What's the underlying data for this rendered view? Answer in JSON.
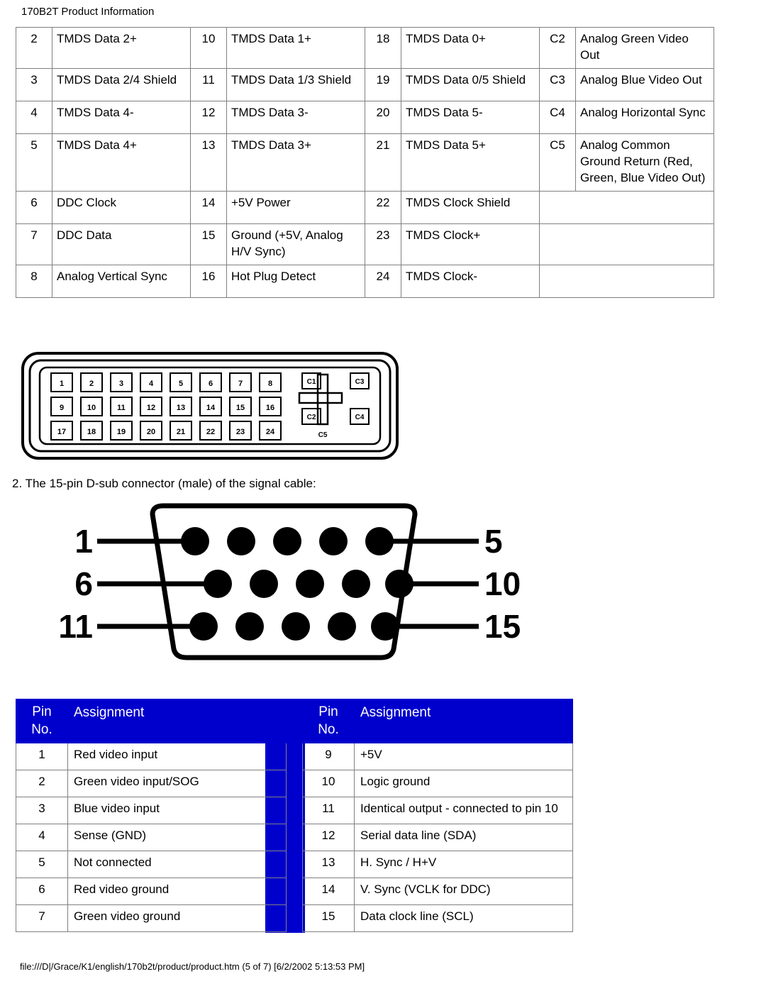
{
  "header": {
    "title": "170B2T Product Information"
  },
  "footer": {
    "text": "file:///D|/Grace/K1/english/170b2t/product/product.htm (5 of 7) [6/2/2002 5:13:53 PM]"
  },
  "caption": {
    "text": "2. The 15-pin D-sub connector (male) of the signal cable:"
  },
  "dvi_table": {
    "rows": [
      [
        {
          "pin": "2",
          "name": "TMDS Data 2+"
        },
        {
          "pin": "10",
          "name": "TMDS Data 1+"
        },
        {
          "pin": "18",
          "name": "TMDS Data 0+"
        },
        {
          "pin": "C2",
          "name": "Analog Green Video Out"
        }
      ],
      [
        {
          "pin": "3",
          "name": "TMDS Data 2/4 Shield"
        },
        {
          "pin": "11",
          "name": "TMDS Data 1/3 Shield"
        },
        {
          "pin": "19",
          "name": "TMDS Data 0/5 Shield"
        },
        {
          "pin": "C3",
          "name": "Analog Blue Video Out"
        }
      ],
      [
        {
          "pin": "4",
          "name": "TMDS Data 4-"
        },
        {
          "pin": "12",
          "name": "TMDS Data 3-"
        },
        {
          "pin": "20",
          "name": "TMDS Data 5-"
        },
        {
          "pin": "C4",
          "name": "Analog Horizontal Sync"
        }
      ],
      [
        {
          "pin": "5",
          "name": "TMDS Data 4+"
        },
        {
          "pin": "13",
          "name": "TMDS Data 3+"
        },
        {
          "pin": "21",
          "name": "TMDS Data 5+"
        },
        {
          "pin": "C5",
          "name": "Analog Common Ground Return (Red, Green, Blue Video Out)"
        }
      ],
      [
        {
          "pin": "6",
          "name": "DDC Clock"
        },
        {
          "pin": "14",
          "name": "+5V Power"
        },
        {
          "pin": "22",
          "name": "TMDS Clock Shield"
        },
        {
          "pin": "",
          "name": ""
        }
      ],
      [
        {
          "pin": "7",
          "name": "DDC Data"
        },
        {
          "pin": "15",
          "name": "Ground (+5V, Analog H/V Sync)"
        },
        {
          "pin": "23",
          "name": "TMDS Clock+"
        },
        {
          "pin": "",
          "name": ""
        }
      ],
      [
        {
          "pin": "8",
          "name": "Analog Vertical Sync"
        },
        {
          "pin": "16",
          "name": "Hot Plug Detect"
        },
        {
          "pin": "24",
          "name": "TMDS Clock-"
        },
        {
          "pin": "",
          "name": ""
        }
      ]
    ]
  },
  "dvi_connector": {
    "row1": [
      "1",
      "2",
      "3",
      "4",
      "5",
      "6",
      "7",
      "8"
    ],
    "row2": [
      "9",
      "10",
      "11",
      "12",
      "13",
      "14",
      "15",
      "16"
    ],
    "row3": [
      "17",
      "18",
      "19",
      "20",
      "21",
      "22",
      "23",
      "24"
    ],
    "c_pins": [
      "C1",
      "C3",
      "C2",
      "C4",
      "C5"
    ]
  },
  "dsub_connector": {
    "labels_left": [
      "1",
      "6",
      "11"
    ],
    "labels_right": [
      "5",
      "10",
      "15"
    ]
  },
  "vga_table": {
    "headers": {
      "pin": "Pin No.",
      "assignment": "Assignment"
    },
    "left_rows": [
      {
        "pin": "1",
        "assignment": "Red video input"
      },
      {
        "pin": "2",
        "assignment": "Green video input/SOG"
      },
      {
        "pin": "3",
        "assignment": "Blue video input"
      },
      {
        "pin": "4",
        "assignment": "Sense (GND)"
      },
      {
        "pin": "5",
        "assignment": "Not connected"
      },
      {
        "pin": "6",
        "assignment": "Red video ground"
      },
      {
        "pin": "7",
        "assignment": "Green video ground"
      }
    ],
    "right_rows": [
      {
        "pin": "9",
        "assignment": "+5V"
      },
      {
        "pin": "10",
        "assignment": "Logic ground"
      },
      {
        "pin": "11",
        "assignment": "Identical output - connected to pin 10"
      },
      {
        "pin": "12",
        "assignment": "Serial data line (SDA)"
      },
      {
        "pin": "13",
        "assignment": "H. Sync / H+V"
      },
      {
        "pin": "14",
        "assignment": "V. Sync (VCLK for DDC)"
      },
      {
        "pin": "15",
        "assignment": "Data clock line (SCL)"
      }
    ]
  },
  "colors": {
    "header_blue": "#0000cc",
    "border_gray": "#808080"
  }
}
